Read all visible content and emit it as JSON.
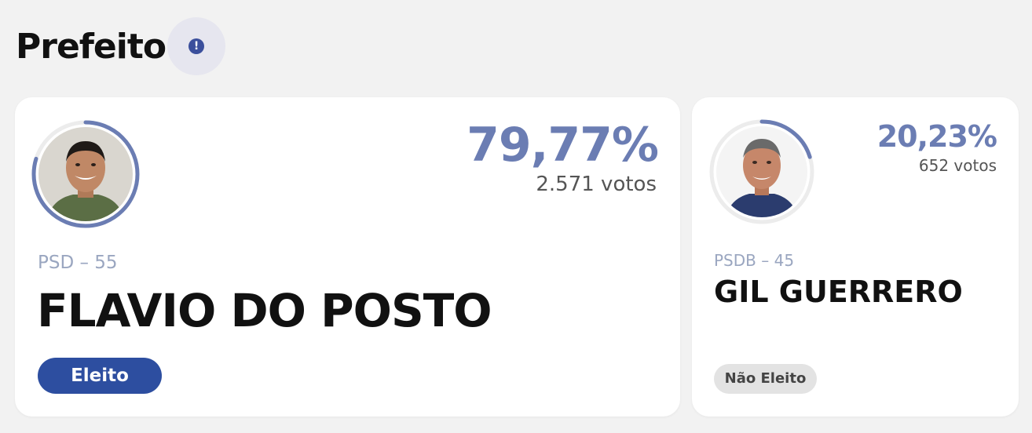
{
  "section": {
    "title": "Prefeito",
    "info_icon": "exclamation-icon",
    "info_glyph": "!"
  },
  "colors": {
    "accent": "#6b7db3",
    "ring": "#6b7db3",
    "elected_badge": "#2d4ea0",
    "not_elected_badge": "#e3e3e3"
  },
  "candidates": [
    {
      "percent": "79,77%",
      "votes": "2.571 votos",
      "vote_share": 0.7977,
      "party": "PSD – 55",
      "name": "FLAVIO DO POSTO",
      "status": "Eleito"
    },
    {
      "percent": "20,23%",
      "votes": "652 votos",
      "vote_share": 0.2023,
      "party": "PSDB – 45",
      "name": "GIL GUERRERO",
      "status": "Não Eleito"
    }
  ]
}
